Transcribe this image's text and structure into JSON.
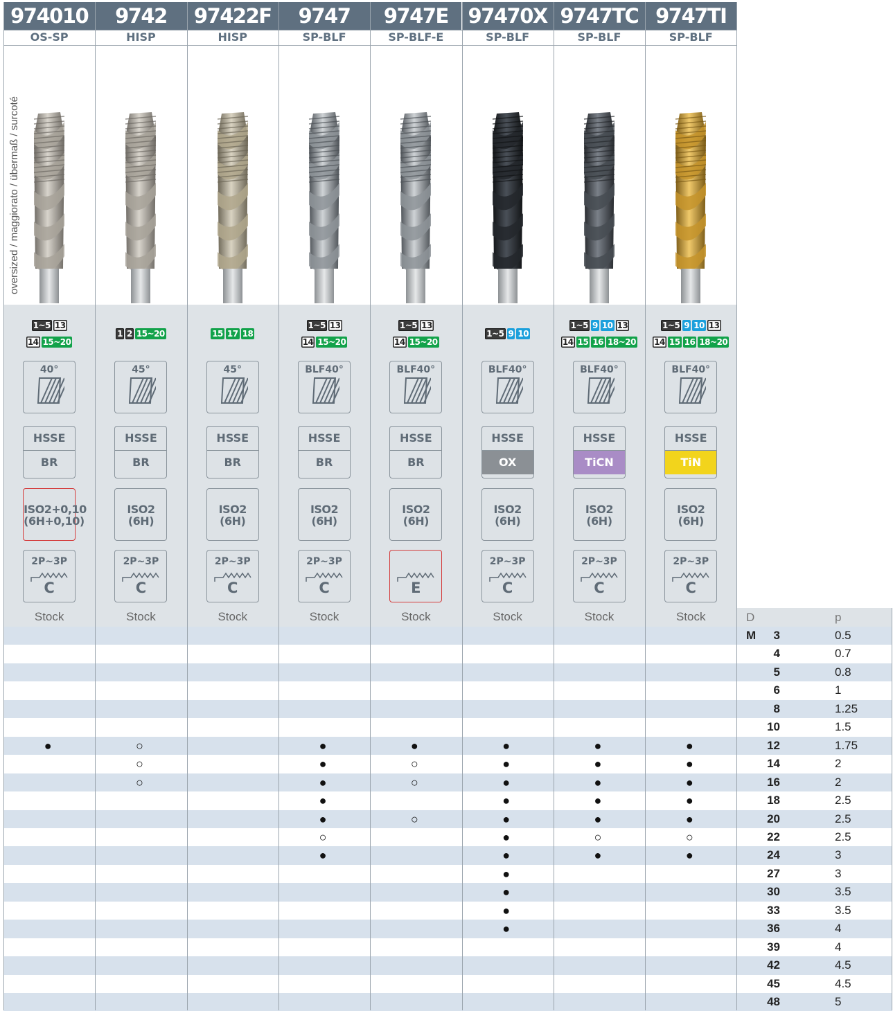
{
  "columns": [
    {
      "code": "974010",
      "type": "OS-SP",
      "helix": "40°",
      "material_top": "HSSE",
      "material_bottom": "BR",
      "material_style": "plain",
      "tolerance": [
        "ISO2+0,10",
        "(6H+0,10)"
      ],
      "tol_red": true,
      "chamfer_label": "2P~3P",
      "chamfer_letter": "C",
      "chamfer_red": false,
      "stock": "Stock",
      "finish": "bright",
      "badges": [
        [
          {
            "t": "1~5",
            "s": "dark"
          },
          {
            "t": "13",
            "s": "white"
          }
        ],
        [
          {
            "t": "14",
            "s": "white"
          },
          {
            "t": "15~20",
            "s": "green"
          }
        ]
      ],
      "avail": {
        "12": "full"
      }
    },
    {
      "code": "9742",
      "type": "HISP",
      "helix": "45°",
      "material_top": "HSSE",
      "material_bottom": "BR",
      "material_style": "plain",
      "tolerance": [
        "ISO2",
        "(6H)"
      ],
      "tol_red": false,
      "chamfer_label": "2P~3P",
      "chamfer_letter": "C",
      "chamfer_red": false,
      "stock": "Stock",
      "finish": "bright",
      "badges": [
        [
          {
            "t": "1",
            "s": "dark"
          },
          {
            "t": "2",
            "s": "dark"
          },
          {
            "t": "15~20",
            "s": "green"
          }
        ]
      ],
      "avail": {
        "12": "open",
        "14": "open",
        "16": "open"
      }
    },
    {
      "code": "97422F",
      "type": "HISP",
      "helix": "45°",
      "material_top": "HSSE",
      "material_bottom": "BR",
      "material_style": "plain",
      "tolerance": [
        "ISO2",
        "(6H)"
      ],
      "tol_red": false,
      "chamfer_label": "2P~3P",
      "chamfer_letter": "C",
      "chamfer_red": false,
      "stock": "Stock",
      "finish": "bright2",
      "badges": [
        [
          {
            "t": "15",
            "s": "green"
          },
          {
            "t": "17",
            "s": "green"
          },
          {
            "t": "18",
            "s": "green"
          }
        ]
      ],
      "avail": {}
    },
    {
      "code": "9747",
      "type": "SP-BLF",
      "helix": "BLF40°",
      "material_top": "HSSE",
      "material_bottom": "BR",
      "material_style": "plain",
      "tolerance": [
        "ISO2",
        "(6H)"
      ],
      "tol_red": false,
      "chamfer_label": "2P~3P",
      "chamfer_letter": "C",
      "chamfer_red": false,
      "stock": "Stock",
      "finish": "steel",
      "badges": [
        [
          {
            "t": "1~5",
            "s": "dark"
          },
          {
            "t": "13",
            "s": "white"
          }
        ],
        [
          {
            "t": "14",
            "s": "white"
          },
          {
            "t": "15~20",
            "s": "green"
          }
        ]
      ],
      "avail": {
        "12": "full",
        "14": "full",
        "16": "full",
        "18": "full",
        "20": "full",
        "22": "open",
        "24": "full"
      }
    },
    {
      "code": "9747E",
      "type": "SP-BLF-E",
      "helix": "BLF40°",
      "material_top": "HSSE",
      "material_bottom": "BR",
      "material_style": "plain",
      "tolerance": [
        "ISO2",
        "(6H)"
      ],
      "tol_red": false,
      "chamfer_label": "",
      "chamfer_letter": "E",
      "chamfer_red": true,
      "stock": "Stock",
      "finish": "steel",
      "badges": [
        [
          {
            "t": "1~5",
            "s": "dark"
          },
          {
            "t": "13",
            "s": "white"
          }
        ],
        [
          {
            "t": "14",
            "s": "white"
          },
          {
            "t": "15~20",
            "s": "green"
          }
        ]
      ],
      "avail": {
        "12": "full",
        "14": "open",
        "16": "open",
        "20": "open"
      }
    },
    {
      "code": "97470X",
      "type": "SP-BLF",
      "helix": "BLF40°",
      "material_top": "HSSE",
      "material_bottom": "OX",
      "material_style": "ox",
      "tolerance": [
        "ISO2",
        "(6H)"
      ],
      "tol_red": false,
      "chamfer_label": "2P~3P",
      "chamfer_letter": "C",
      "chamfer_red": false,
      "stock": "Stock",
      "finish": "black",
      "badges": [
        [
          {
            "t": "1~5",
            "s": "dark"
          },
          {
            "t": "9",
            "s": "blue"
          },
          {
            "t": "10",
            "s": "blue"
          }
        ]
      ],
      "avail": {
        "12": "full",
        "14": "full",
        "16": "full",
        "18": "full",
        "20": "full",
        "22": "full",
        "24": "full",
        "27": "full",
        "30": "full",
        "33": "full",
        "36": "full"
      }
    },
    {
      "code": "9747TC",
      "type": "SP-BLF",
      "helix": "BLF40°",
      "material_top": "HSSE",
      "material_bottom": "TiCN",
      "material_style": "ticn",
      "tolerance": [
        "ISO2",
        "(6H)"
      ],
      "tol_red": false,
      "chamfer_label": "2P~3P",
      "chamfer_letter": "C",
      "chamfer_red": false,
      "stock": "Stock",
      "finish": "dark",
      "badges": [
        [
          {
            "t": "1~5",
            "s": "dark"
          },
          {
            "t": "9",
            "s": "blue"
          },
          {
            "t": "10",
            "s": "blue"
          },
          {
            "t": "13",
            "s": "white"
          }
        ],
        [
          {
            "t": "14",
            "s": "white"
          },
          {
            "t": "15",
            "s": "green"
          },
          {
            "t": "16",
            "s": "green"
          },
          {
            "t": "18~20",
            "s": "green"
          }
        ]
      ],
      "avail": {
        "12": "full",
        "14": "full",
        "16": "full",
        "18": "full",
        "20": "full",
        "22": "open",
        "24": "full"
      }
    },
    {
      "code": "9747TI",
      "type": "SP-BLF",
      "helix": "BLF40°",
      "material_top": "HSSE",
      "material_bottom": "TiN",
      "material_style": "tin",
      "tolerance": [
        "ISO2",
        "(6H)"
      ],
      "tol_red": false,
      "chamfer_label": "2P~3P",
      "chamfer_letter": "C",
      "chamfer_red": false,
      "stock": "Stock",
      "finish": "gold",
      "badges": [
        [
          {
            "t": "1~5",
            "s": "dark"
          },
          {
            "t": "9",
            "s": "blue"
          },
          {
            "t": "10",
            "s": "blue"
          },
          {
            "t": "13",
            "s": "white"
          }
        ],
        [
          {
            "t": "14",
            "s": "white"
          },
          {
            "t": "15",
            "s": "green"
          },
          {
            "t": "16",
            "s": "green"
          },
          {
            "t": "18~20",
            "s": "green"
          }
        ]
      ],
      "avail": {
        "12": "full",
        "14": "full",
        "16": "full",
        "18": "full",
        "20": "full",
        "22": "open",
        "24": "full"
      }
    }
  ],
  "side_label": "oversized / maggiorato / übermaß / surcoté",
  "size_header": {
    "d": "D",
    "p": "p"
  },
  "thread_prefix": "M",
  "sizes": [
    {
      "d": "3",
      "p": "0.5"
    },
    {
      "d": "4",
      "p": "0.7"
    },
    {
      "d": "5",
      "p": "0.8"
    },
    {
      "d": "6",
      "p": "1"
    },
    {
      "d": "8",
      "p": "1.25"
    },
    {
      "d": "10",
      "p": "1.5"
    },
    {
      "d": "12",
      "p": "1.75"
    },
    {
      "d": "14",
      "p": "2"
    },
    {
      "d": "16",
      "p": "2"
    },
    {
      "d": "18",
      "p": "2.5"
    },
    {
      "d": "20",
      "p": "2.5"
    },
    {
      "d": "22",
      "p": "2.5"
    },
    {
      "d": "24",
      "p": "3"
    },
    {
      "d": "27",
      "p": "3"
    },
    {
      "d": "30",
      "p": "3.5"
    },
    {
      "d": "33",
      "p": "3.5"
    },
    {
      "d": "36",
      "p": "4"
    },
    {
      "d": "39",
      "p": "4"
    },
    {
      "d": "42",
      "p": "4.5"
    },
    {
      "d": "45",
      "p": "4.5"
    },
    {
      "d": "48",
      "p": "5"
    }
  ],
  "symbols": {
    "full": "●",
    "open": "○"
  },
  "colors": {
    "header": "#5f7080",
    "band": "#dee3e7",
    "stripe": "#d7e1ec",
    "ox": "#8b9095",
    "ticn": "#a98cc6",
    "tin": "#f2d41c",
    "red": "#d43a3a"
  }
}
